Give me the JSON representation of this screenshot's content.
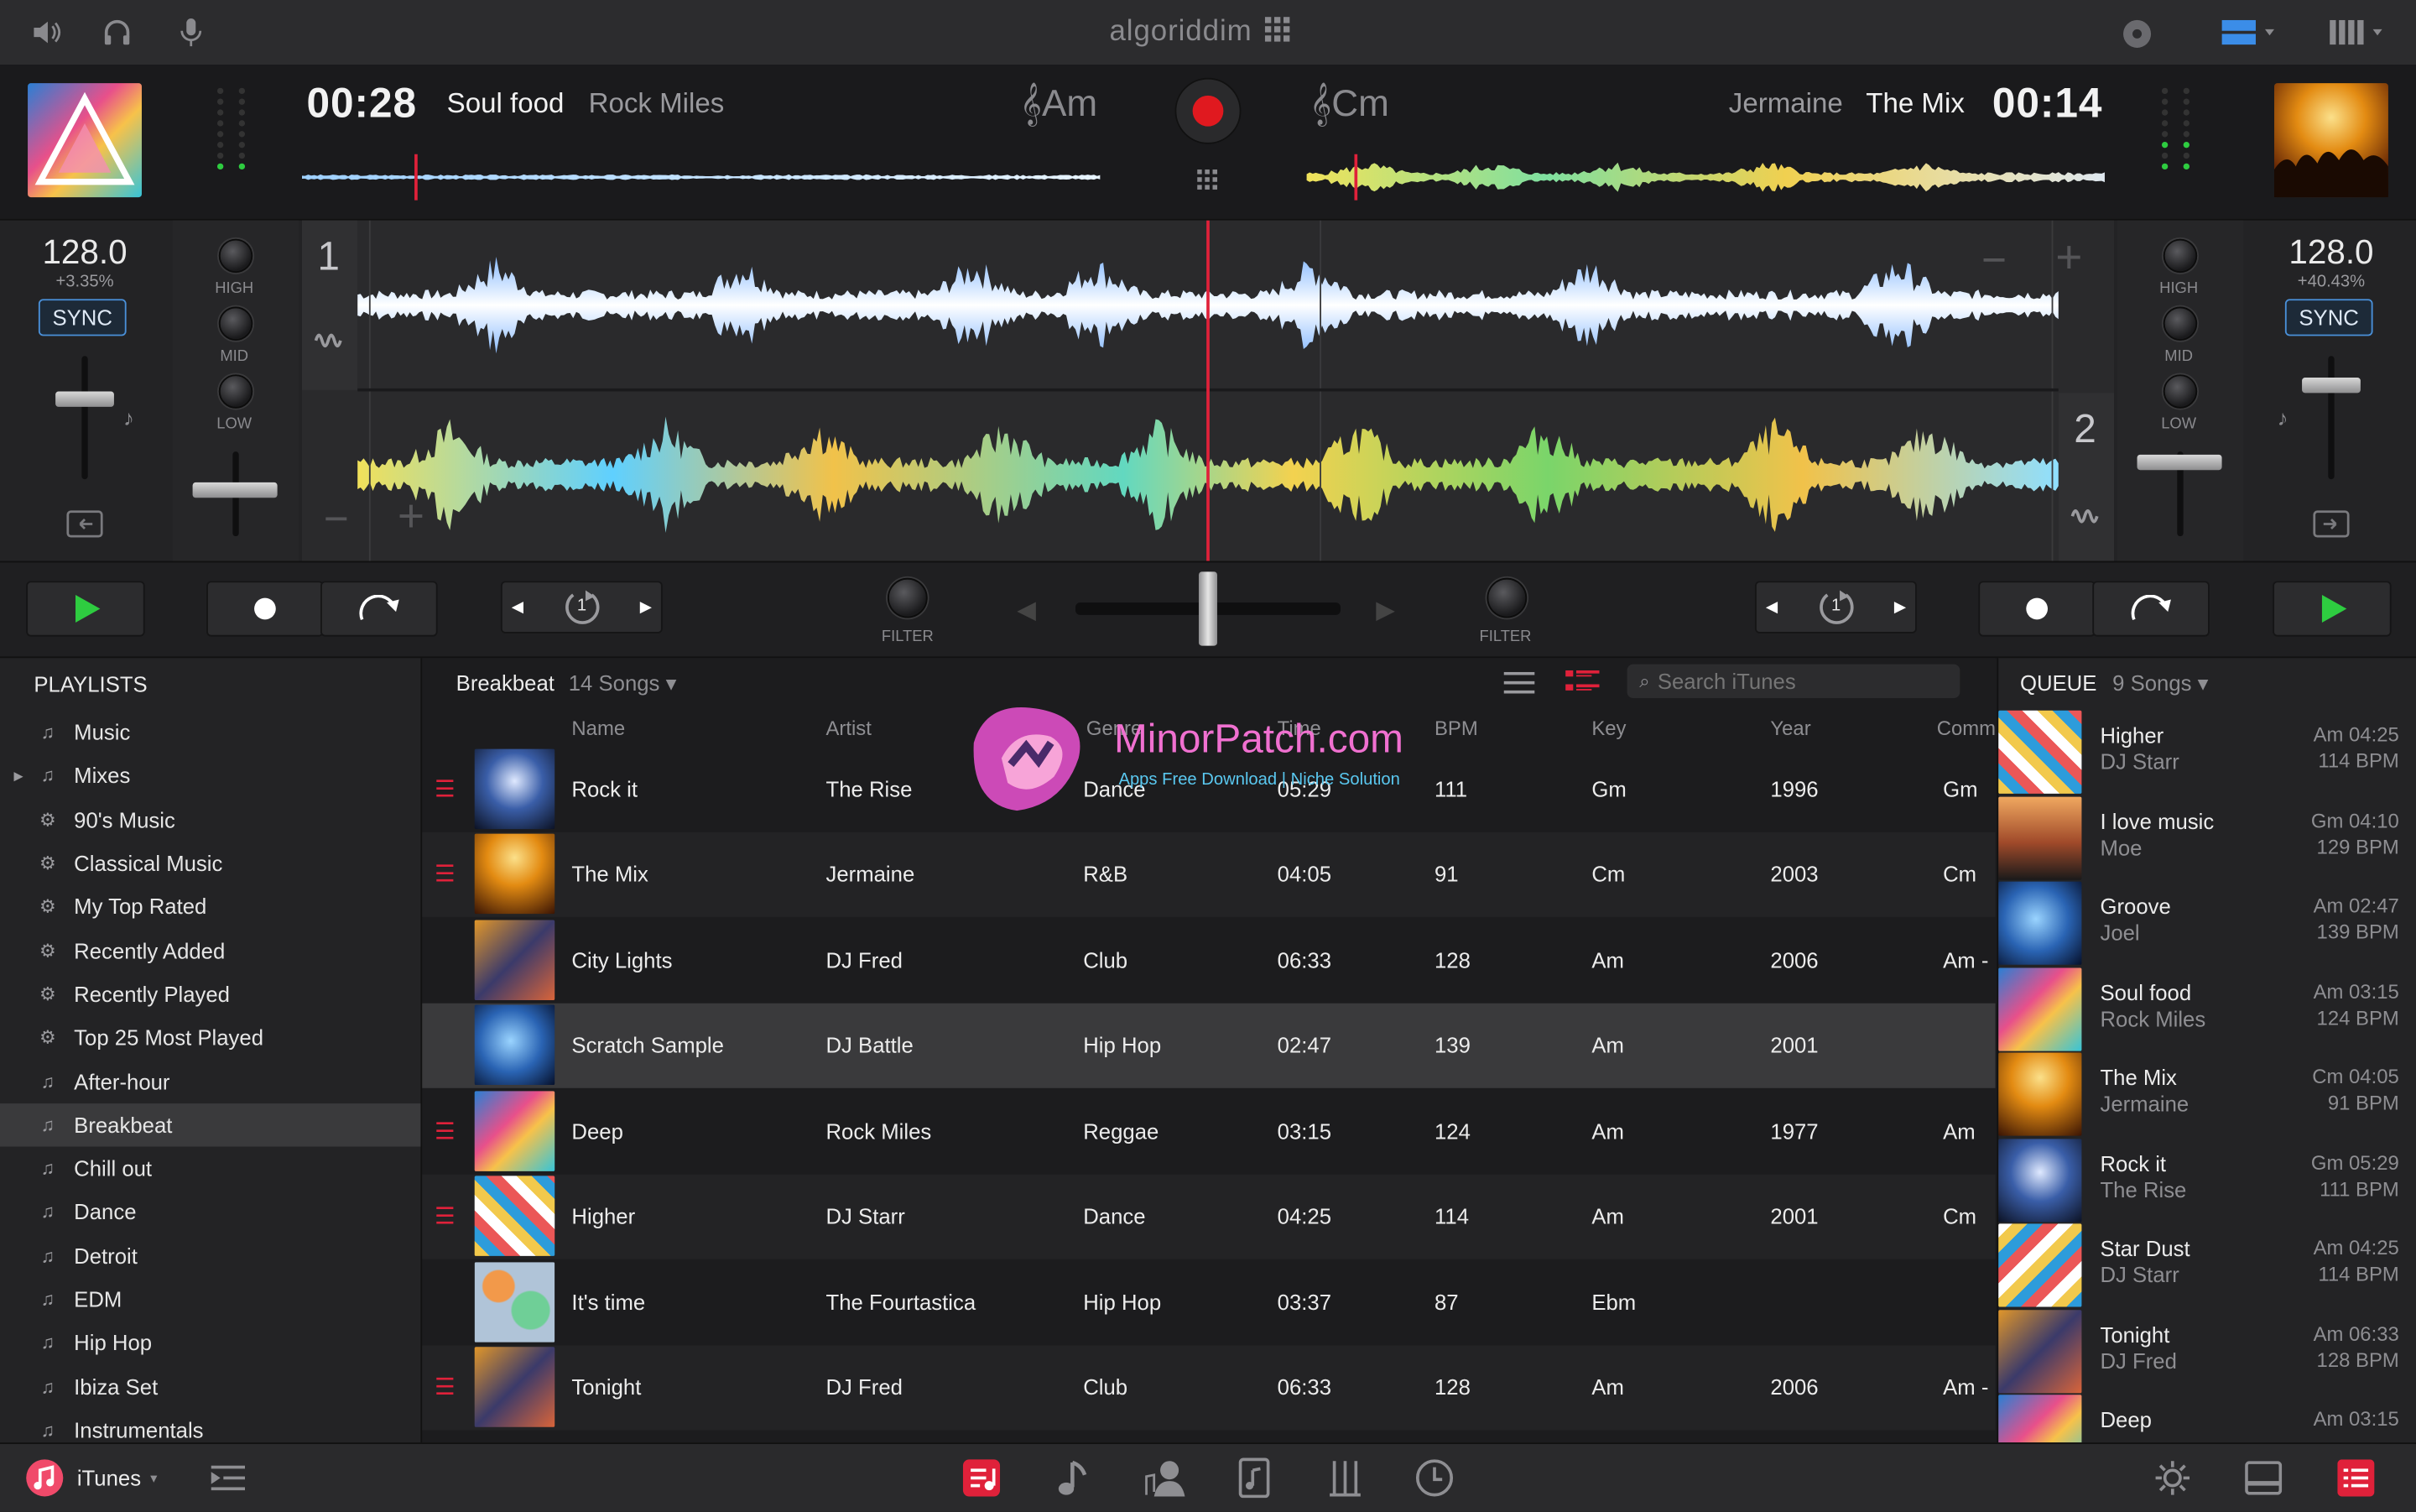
{
  "brand": {
    "logo": "algoriddim"
  },
  "top_bar": {
    "icons": [
      "speaker-icon",
      "headphones-icon",
      "microphone-icon",
      "record-indicator-icon",
      "layout-icon",
      "columns-icon"
    ]
  },
  "deck_left": {
    "time": "00:28",
    "title": "Soul food",
    "artist": "Rock Miles",
    "key": "Am",
    "bpm": "128.0",
    "pitch": "+3.35%",
    "sync_label": "SYNC",
    "deck_number": "1",
    "filter_label": "FILTER",
    "loop_count": "1"
  },
  "deck_right": {
    "time": "00:14",
    "title": "The Mix",
    "artist": "Jermaine",
    "key": "Cm",
    "bpm": "128.0",
    "pitch": "+40.43%",
    "sync_label": "SYNC",
    "deck_number": "2",
    "filter_label": "FILTER",
    "loop_count": "1"
  },
  "eq_labels": {
    "high": "HIGH",
    "mid": "MID",
    "low": "LOW"
  },
  "playlists": {
    "header": "PLAYLISTS",
    "items": [
      {
        "label": "Music",
        "icon": "music-note-icon"
      },
      {
        "label": "Mixes",
        "icon": "music-note-icon"
      },
      {
        "label": "90's Music",
        "icon": "smart-playlist-gear-icon"
      },
      {
        "label": "Classical Music",
        "icon": "smart-playlist-gear-icon"
      },
      {
        "label": "My Top Rated",
        "icon": "smart-playlist-gear-icon"
      },
      {
        "label": "Recently Added",
        "icon": "smart-playlist-gear-icon"
      },
      {
        "label": "Recently Played",
        "icon": "smart-playlist-gear-icon"
      },
      {
        "label": "Top 25 Most Played",
        "icon": "smart-playlist-gear-icon"
      },
      {
        "label": "After-hour",
        "icon": "music-note-icon"
      },
      {
        "label": "Breakbeat",
        "icon": "music-note-icon"
      },
      {
        "label": "Chill out",
        "icon": "music-note-icon"
      },
      {
        "label": "Dance",
        "icon": "music-note-icon"
      },
      {
        "label": "Detroit",
        "icon": "music-note-icon"
      },
      {
        "label": "EDM",
        "icon": "music-note-icon"
      },
      {
        "label": "Hip Hop",
        "icon": "music-note-icon"
      },
      {
        "label": "Ibiza Set",
        "icon": "music-note-icon"
      },
      {
        "label": "Instrumentals",
        "icon": "music-note-icon"
      }
    ]
  },
  "tracks": {
    "playlist_name": "Breakbeat",
    "count": "14 Songs",
    "search_placeholder": "Search iTunes",
    "columns": [
      "Name",
      "Artist",
      "Genre",
      "Time",
      "BPM",
      "Key",
      "Year",
      "Comm"
    ],
    "rows": [
      {
        "name": "Rock it",
        "artist": "The Rise",
        "genre": "Dance",
        "time": "05:29",
        "bpm": "111",
        "key": "Gm",
        "year": "1996",
        "comment": "Gm"
      },
      {
        "name": "The Mix",
        "artist": "Jermaine",
        "genre": "R&B",
        "time": "04:05",
        "bpm": "91",
        "key": "Cm",
        "year": "2003",
        "comment": "Cm"
      },
      {
        "name": "City Lights",
        "artist": "DJ Fred",
        "genre": "Club",
        "time": "06:33",
        "bpm": "128",
        "key": "Am",
        "year": "2006",
        "comment": "Am -"
      },
      {
        "name": "Scratch Sample",
        "artist": "DJ Battle",
        "genre": "Hip Hop",
        "time": "02:47",
        "bpm": "139",
        "key": "Am",
        "year": "2001",
        "comment": ""
      },
      {
        "name": "Deep",
        "artist": "Rock Miles",
        "genre": "Reggae",
        "time": "03:15",
        "bpm": "124",
        "key": "Am",
        "year": "1977",
        "comment": "Am"
      },
      {
        "name": "Higher",
        "artist": "DJ Starr",
        "genre": "Dance",
        "time": "04:25",
        "bpm": "114",
        "key": "Am",
        "year": "2001",
        "comment": "Cm"
      },
      {
        "name": "It's time",
        "artist": "The Fourtastica",
        "genre": "Hip Hop",
        "time": "03:37",
        "bpm": "87",
        "key": "Ebm",
        "year": "",
        "comment": ""
      },
      {
        "name": "Tonight",
        "artist": "DJ Fred",
        "genre": "Club",
        "time": "06:33",
        "bpm": "128",
        "key": "Am",
        "year": "2006",
        "comment": "Am -"
      }
    ]
  },
  "queue": {
    "header": "QUEUE",
    "count": "9 Songs",
    "items": [
      {
        "title": "Higher",
        "artist": "DJ Starr",
        "meta": "Am 04:25",
        "bpm": "114 BPM"
      },
      {
        "title": "I love music",
        "artist": "Moe",
        "meta": "Gm 04:10",
        "bpm": "129 BPM"
      },
      {
        "title": "Groove",
        "artist": "Joel",
        "meta": "Am 02:47",
        "bpm": "139 BPM"
      },
      {
        "title": "Soul food",
        "artist": "Rock Miles",
        "meta": "Am 03:15",
        "bpm": "124 BPM"
      },
      {
        "title": "The Mix",
        "artist": "Jermaine",
        "meta": "Cm 04:05",
        "bpm": "91 BPM"
      },
      {
        "title": "Rock it",
        "artist": "The Rise",
        "meta": "Gm 05:29",
        "bpm": "111 BPM"
      },
      {
        "title": "Star Dust",
        "artist": "DJ Starr",
        "meta": "Am 04:25",
        "bpm": "114 BPM"
      },
      {
        "title": "Tonight",
        "artist": "DJ Fred",
        "meta": "Am 06:33",
        "bpm": "128 BPM"
      },
      {
        "title": "Deep",
        "artist": "",
        "meta": "Am 03:15",
        "bpm": ""
      }
    ]
  },
  "bottom_bar": {
    "source_label": "iTunes",
    "icons": [
      "music-library-icon",
      "note-icon",
      "artist-icon",
      "album-icon",
      "instruments-icon",
      "history-icon",
      "settings-sun-icon",
      "video-icon",
      "list-icon"
    ]
  },
  "watermark": {
    "title": "MinorPatch.com",
    "tagline": "Apps Free Download | Niche Solution"
  },
  "colors": {
    "accent_red": "#e0213a",
    "play_green": "#2ecc40",
    "sync_blue": "#4a90d9",
    "rec_red": "#e0191f"
  }
}
